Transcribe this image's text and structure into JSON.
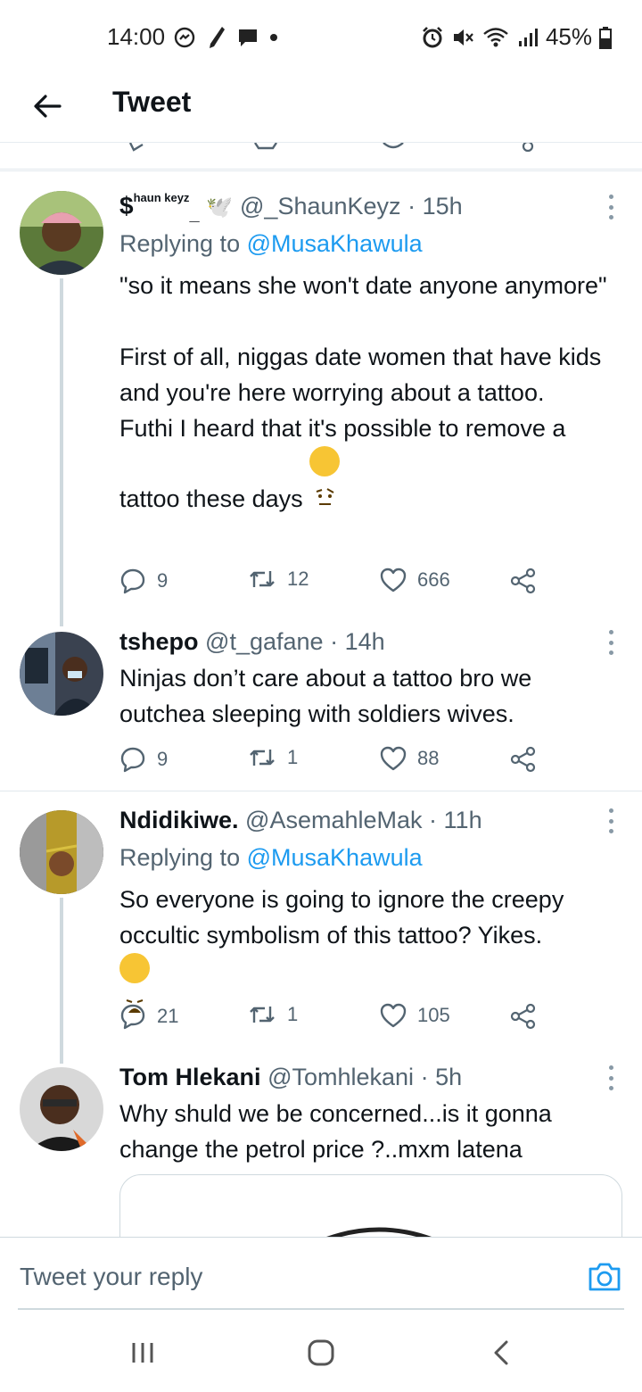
{
  "status_bar": {
    "time": "14:00",
    "battery": "45%",
    "left_icons": [
      "messenger-icon",
      "pen-icon",
      "chat-bubble-icon",
      "dot-icon"
    ],
    "right_icons": [
      "alarm-icon",
      "mute-icon",
      "wifi-icon",
      "signal-icon",
      "battery-icon"
    ]
  },
  "header": {
    "title": "Tweet"
  },
  "tweets": [
    {
      "name_prefix": "$",
      "name_sup": "haun keyz",
      "name_sub": "_",
      "name_emoji": "🕊️",
      "handle": "@_ShaunKeyz",
      "time": "15h",
      "replying_label": "Replying to",
      "replying_to": "@MusaKhawula",
      "body": "\"so it means she won't date anyone anymore\"\n\nFirst of all, niggas date women that have kids and you're here worrying about a tattoo.\nFuthi I heard that it's possible to remove a tattoo these days",
      "emoji": "🤨",
      "replies": "9",
      "retweets": "12",
      "likes": "666"
    },
    {
      "name": "tshepo",
      "handle": "@t_gafane",
      "time": "14h",
      "body": "Ninjas don’t care about a tattoo bro we outchea sleeping with soldiers wives.",
      "replies": "9",
      "retweets": "1",
      "likes": "88"
    },
    {
      "name": "Ndidikiwe.",
      "handle": "@AsemahleMak",
      "time": "11h",
      "replying_label": "Replying to",
      "replying_to": "@MusaKhawula",
      "body": "So everyone is going to ignore the creepy occultic symbolism of this tattoo? Yikes.",
      "emoji": "😩",
      "replies": "21",
      "retweets": "1",
      "likes": "105"
    },
    {
      "name": "Tom Hlekani",
      "handle": "@Tomhlekani",
      "time": "5h",
      "body": "Why shuld we be concerned...is it gonna change the petrol price ?..mxm latena"
    }
  ],
  "reply_bar": {
    "placeholder": "Tweet your reply"
  },
  "colors": {
    "accent": "#1d9bf0",
    "text": "#0f1419",
    "muted": "#536471",
    "divider": "#e1e8ed"
  }
}
